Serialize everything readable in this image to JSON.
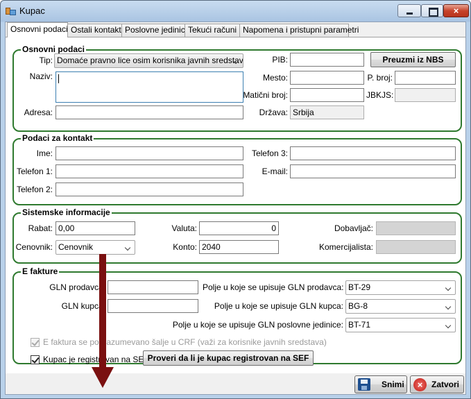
{
  "window": {
    "title": "Kupac",
    "close_glyph": "×"
  },
  "tabs": [
    "Osnovni podaci",
    "Ostali kontakti",
    "Poslovne jedinice",
    "Tekući računi",
    "Napomena i pristupni parametri"
  ],
  "osnovni": {
    "title": "Osnovni podaci",
    "tip_label": "Tip:",
    "tip_value": "Domaće pravno lice osim korisnika javnih sredstava",
    "naziv_label": "Naziv:",
    "adresa_label": "Adresa:",
    "pib_label": "PIB:",
    "preuzmi_button": "Preuzmi iz NBS",
    "mesto_label": "Mesto:",
    "pbroj_label": "P. broj:",
    "maticni_label": "Matični broj:",
    "jbkjs_label": "JBKJS:",
    "drzava_label": "Država:",
    "drzava_value": "Srbija"
  },
  "kontakt": {
    "title": "Podaci za kontakt",
    "ime_label": "Ime:",
    "telefon1_label": "Telefon 1:",
    "telefon2_label": "Telefon 2:",
    "telefon3_label": "Telefon 3:",
    "email_label": "E-mail:"
  },
  "sistemske": {
    "title": "Sistemske informacije",
    "rabat_label": "Rabat:",
    "rabat_value": "0,00",
    "cenovnik_label": "Cenovnik:",
    "cenovnik_value": "Cenovnik",
    "valuta_label": "Valuta:",
    "valuta_value": "0",
    "konto_label": "Konto:",
    "konto_value": "2040",
    "dobavljac_label": "Dobavljač:",
    "komercijalista_label": "Komercijalista:"
  },
  "efakture": {
    "title": "E fakture",
    "gln_prodavca_label": "GLN prodavca:",
    "gln_kupca_label": "GLN kupca:",
    "polje_prodavca_label": "Polje u koje se upisuje GLN prodavca:",
    "polje_prodavca_value": "BT-29",
    "polje_kupca_label": "Polje u koje se upisuje GLN kupca:",
    "polje_kupca_value": "BG-8",
    "polje_pj_label": "Polje u koje se upisuje GLN poslovne jedinice:",
    "polje_pj_value": "BT-71",
    "crf_checkbox": "E faktura se podrazumevano šalje u CRF (važi za korisnike javnih sredstava)",
    "sef_checkbox": "Kupac je registrovan na SEF",
    "proveri_button": "Proveri da li je kupac registrovan na SEF"
  },
  "footer": {
    "snimi_button": "Snimi",
    "zatvori_button": "Zatvori"
  }
}
